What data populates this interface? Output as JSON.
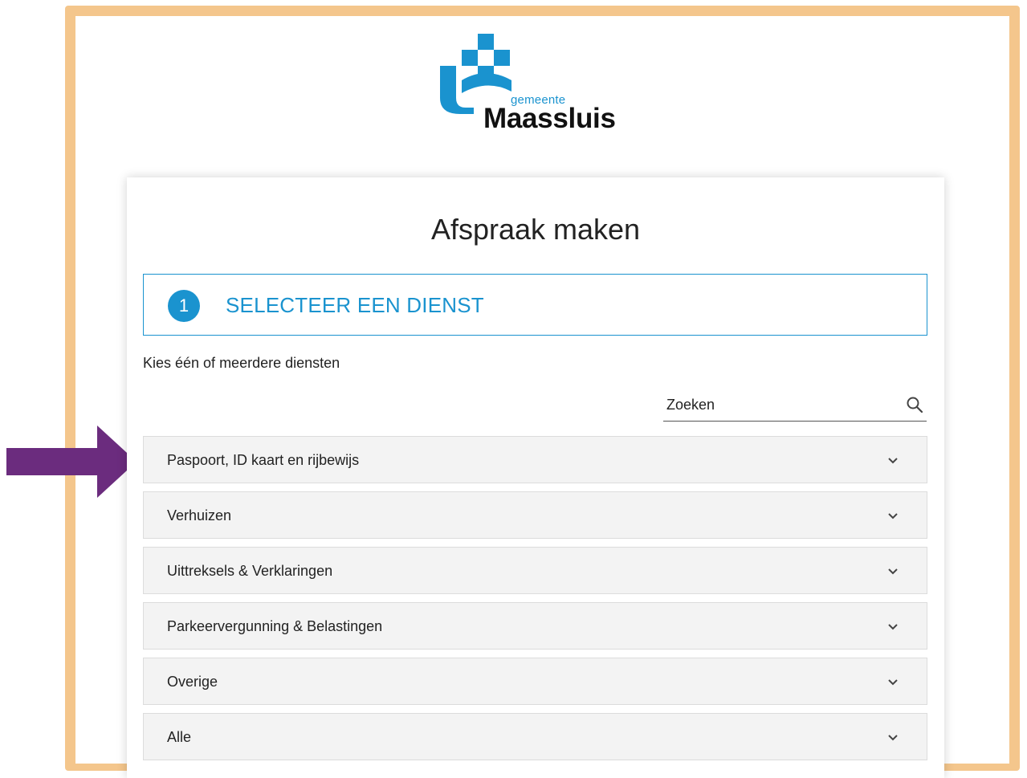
{
  "logo": {
    "small_text": "gemeente",
    "big_text": "Maassluis"
  },
  "page": {
    "title": "Afspraak maken",
    "step": {
      "number": "1",
      "label": "SELECTEER EEN DIENST"
    },
    "hint": "Kies één of meerdere diensten",
    "search": {
      "placeholder": "Zoeken",
      "value": ""
    },
    "categories": [
      {
        "label": "Paspoort, ID kaart en rijbewijs"
      },
      {
        "label": "Verhuizen"
      },
      {
        "label": "Uittreksels & Verklaringen"
      },
      {
        "label": "Parkeervergunning & Belastingen"
      },
      {
        "label": "Overige"
      },
      {
        "label": "Alle"
      }
    ]
  },
  "colors": {
    "accent": "#1a93cf",
    "frame": "#f4c68c",
    "arrow": "#6b2c7e",
    "accordion_bg": "#f3f3f3"
  },
  "icons": {
    "search": "search-icon",
    "chevron": "chevron-down-icon",
    "pointer_arrow": "arrow-right-icon"
  }
}
